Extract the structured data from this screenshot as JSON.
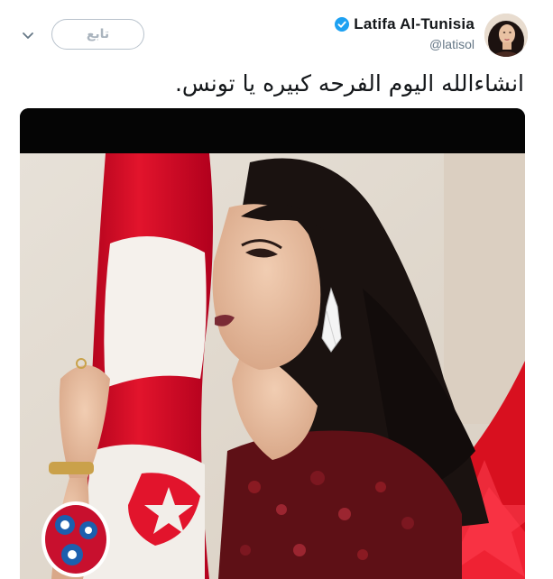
{
  "tweet": {
    "follow_label": "تابع",
    "display_name": "Latifa Al-Tunisia",
    "handle": "@latisol",
    "text": "انشاءالله اليوم الفرحه كبيره يا تونس."
  },
  "icons": {
    "caret": "chevron-down-icon",
    "verified": "verified-badge-icon"
  },
  "colors": {
    "verified_blue": "#1da1f2",
    "name_text": "#14171a",
    "handle_text": "#657786",
    "button_border": "#b8c2cc",
    "flag_red": "#e0001b"
  }
}
